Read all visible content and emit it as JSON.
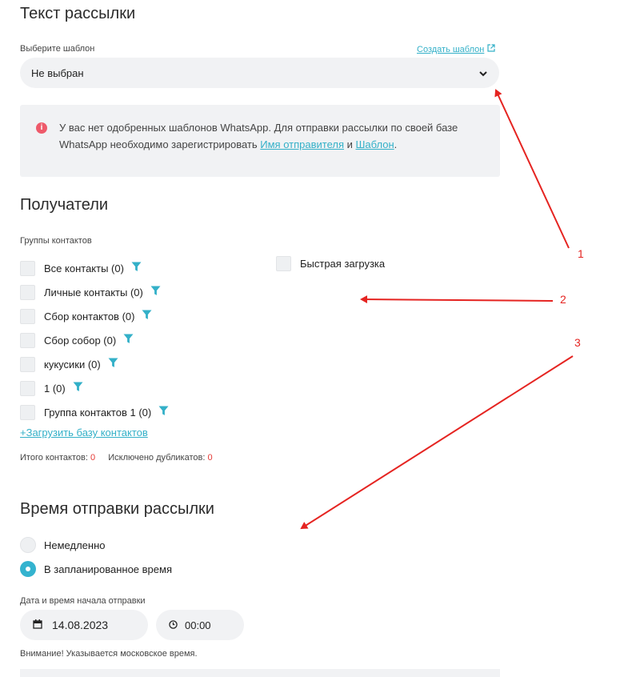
{
  "template_section": {
    "title": "Текст рассылки",
    "select_label": "Выберите шаблон",
    "create_link": "Создать шаблон",
    "selected_value": "Не выбран",
    "info_part1": "У вас нет одобренных шаблонов WhatsApp. Для отправки рассылки по своей базе WhatsApp необходимо зарегистрировать ",
    "info_link1": "Имя отправителя",
    "info_and": " и ",
    "info_link2": "Шаблон",
    "info_end": "."
  },
  "recipients": {
    "title": "Получатели",
    "groups_label": "Группы контактов",
    "groups": [
      {
        "label": "Все контакты (0)"
      },
      {
        "label": "Личные контакты (0)"
      },
      {
        "label": "Сбор контактов (0)"
      },
      {
        "label": "Сбор собор (0)"
      },
      {
        "label": "кукусики (0)"
      },
      {
        "label": "1 (0)"
      },
      {
        "label": "Группа контактов 1 (0)"
      }
    ],
    "quick_upload": "Быстрая загрузка",
    "upload_link": "+Загрузить базу контактов",
    "total_label": "Итого контактов:",
    "total_value": "0",
    "duplicates_label": "Исключено дубликатов:",
    "duplicates_value": "0"
  },
  "send_time": {
    "title": "Время отправки рассылки",
    "options": [
      {
        "label": "Немедленно",
        "selected": false
      },
      {
        "label": "В запланированное время",
        "selected": true
      }
    ],
    "datetime_label": "Дата и время начала отправки",
    "date": "14.08.2023",
    "time": "00:00",
    "note": "Внимание! Указывается московское время."
  },
  "annotations": [
    "1",
    "2",
    "3"
  ],
  "colors": {
    "accent": "#33b0c8",
    "error": "#ee5a6a",
    "annotation": "#e52421",
    "field_bg": "#f1f2f4"
  }
}
